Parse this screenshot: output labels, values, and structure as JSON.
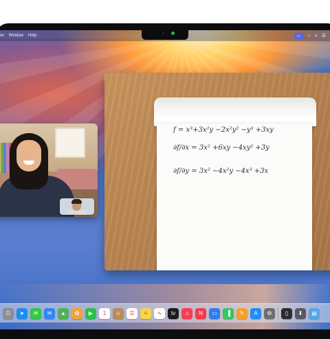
{
  "menubar": {
    "items": [
      "ow",
      "Window",
      "Help"
    ]
  },
  "equations": [
    "f = x³+3x²y −2x²y² −y³ +3xy",
    "∂f/∂x = 3x² +6xy −4xy² +3y",
    "∂f/∂y = 3x² −4x²y −4x³ +3x"
  ],
  "dock": {
    "apps": [
      {
        "icon": "launchpad-icon",
        "glyph": "☷",
        "color": "#8e8e93"
      },
      {
        "icon": "safari-icon",
        "glyph": "➤",
        "color": "#1c8cf0"
      },
      {
        "icon": "messages-icon",
        "glyph": "✉",
        "color": "#33c748"
      },
      {
        "icon": "mail-icon",
        "glyph": "✉",
        "color": "#2f86f6"
      },
      {
        "icon": "maps-icon",
        "glyph": "▲",
        "color": "#4fb05a"
      },
      {
        "icon": "photos-icon",
        "glyph": "✿",
        "color": "#f2a33a"
      },
      {
        "icon": "facetime-icon",
        "glyph": "▶",
        "color": "#2bbf46"
      },
      {
        "icon": "calendar-icon",
        "glyph": "1",
        "color": "#ffffff"
      },
      {
        "icon": "contacts-icon",
        "glyph": "☺",
        "color": "#b98a5a"
      },
      {
        "icon": "reminders-icon",
        "glyph": "☰",
        "color": "#ffffff"
      },
      {
        "icon": "notes-icon",
        "glyph": "≡",
        "color": "#f7d54a"
      },
      {
        "icon": "freeform-icon",
        "glyph": "∿",
        "color": "#ffffff"
      },
      {
        "icon": "tv-icon",
        "glyph": "tv",
        "color": "#1c1c1e"
      },
      {
        "icon": "music-icon",
        "glyph": "♫",
        "color": "#fa3c55"
      },
      {
        "icon": "news-icon",
        "glyph": "N",
        "color": "#f43b4b"
      },
      {
        "icon": "keynote-icon",
        "glyph": "▭",
        "color": "#2f7df0"
      },
      {
        "icon": "numbers-icon",
        "glyph": "▐",
        "color": "#34c759"
      },
      {
        "icon": "pages-icon",
        "glyph": "✎",
        "color": "#f59e2a"
      },
      {
        "icon": "app-store-icon",
        "glyph": "A",
        "color": "#1e8ef7"
      },
      {
        "icon": "system-settings-icon",
        "glyph": "⚙",
        "color": "#6d6d73"
      },
      {
        "icon": "iphone-mirroring-icon",
        "glyph": "▯",
        "color": "#2b2b30"
      },
      {
        "icon": "downloads-icon",
        "glyph": "⬇",
        "color": "#5a5a62"
      },
      {
        "icon": "folder-icon",
        "glyph": "▤",
        "color": "#58a6e8"
      }
    ]
  }
}
